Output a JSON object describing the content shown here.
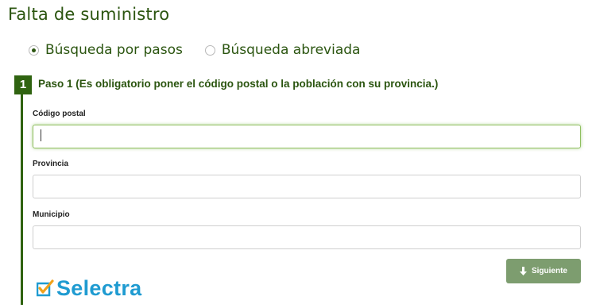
{
  "page": {
    "title": "Falta de suministro"
  },
  "search_mode": {
    "options": [
      {
        "label": "Búsqueda por pasos",
        "selected": true
      },
      {
        "label": "Búsqueda abreviada",
        "selected": false
      }
    ]
  },
  "step": {
    "number": "1",
    "title": "Paso 1 (Es obligatorio poner el código postal o la población con su provincia.)"
  },
  "form": {
    "postal_code": {
      "label": "Código postal",
      "value": ""
    },
    "province": {
      "label": "Provincia",
      "value": ""
    },
    "municipality": {
      "label": "Municipio",
      "value": ""
    }
  },
  "actions": {
    "next_label": "Siguiente"
  },
  "branding": {
    "logo_text": "Selectra"
  },
  "colors": {
    "accent": "#2b5510",
    "button": "#7d9d6f",
    "logo": "#1f9bd1",
    "logo_check": "#f0a21b"
  }
}
